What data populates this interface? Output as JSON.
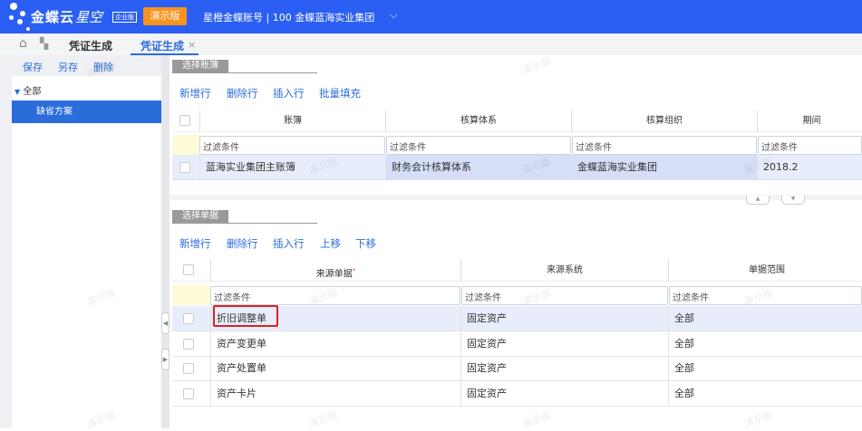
{
  "header": {
    "brand": "金蝶云",
    "brand_sub": "星空",
    "edition_badge": "企业版",
    "demo_button": "演示版",
    "account": "星橙金蝶账号 | 100 金蝶蓝海实业集团",
    "colors": {
      "primary": "#2b5ff3",
      "demo": "#f7931e"
    }
  },
  "tabs": {
    "first": "凭证生成",
    "active": "凭证生成",
    "close": "×"
  },
  "left": {
    "save": "保存",
    "save_as": "另存",
    "delete": "删除",
    "tree_root": "全部",
    "tree_selected": "缺省方案"
  },
  "section1": {
    "title": "选择账簿",
    "toolbar": [
      "新增行",
      "删除行",
      "插入行",
      "批量填充"
    ],
    "columns": [
      "账簿",
      "核算体系",
      "核算组织",
      "期间"
    ],
    "filter_placeholder": "过滤条件",
    "rows": [
      [
        "蓝海实业集团主账簿",
        "财务会计核算体系",
        "金蝶蓝海实业集团",
        "2018.2"
      ]
    ]
  },
  "section2": {
    "title": "选择单据",
    "toolbar": [
      "新增行",
      "删除行",
      "插入行",
      "上移",
      "下移"
    ],
    "columns": [
      "来源单据",
      "来源系统",
      "单据范围"
    ],
    "required_mark": "*",
    "filter_placeholder": "过滤条件",
    "rows": [
      [
        "折旧调整单",
        "固定资产",
        "全部"
      ],
      [
        "资产变更单",
        "固定资产",
        "全部"
      ],
      [
        "资产处置单",
        "固定资产",
        "全部"
      ],
      [
        "资产卡片",
        "固定资产",
        "全部"
      ]
    ]
  },
  "watermark": "演示版"
}
